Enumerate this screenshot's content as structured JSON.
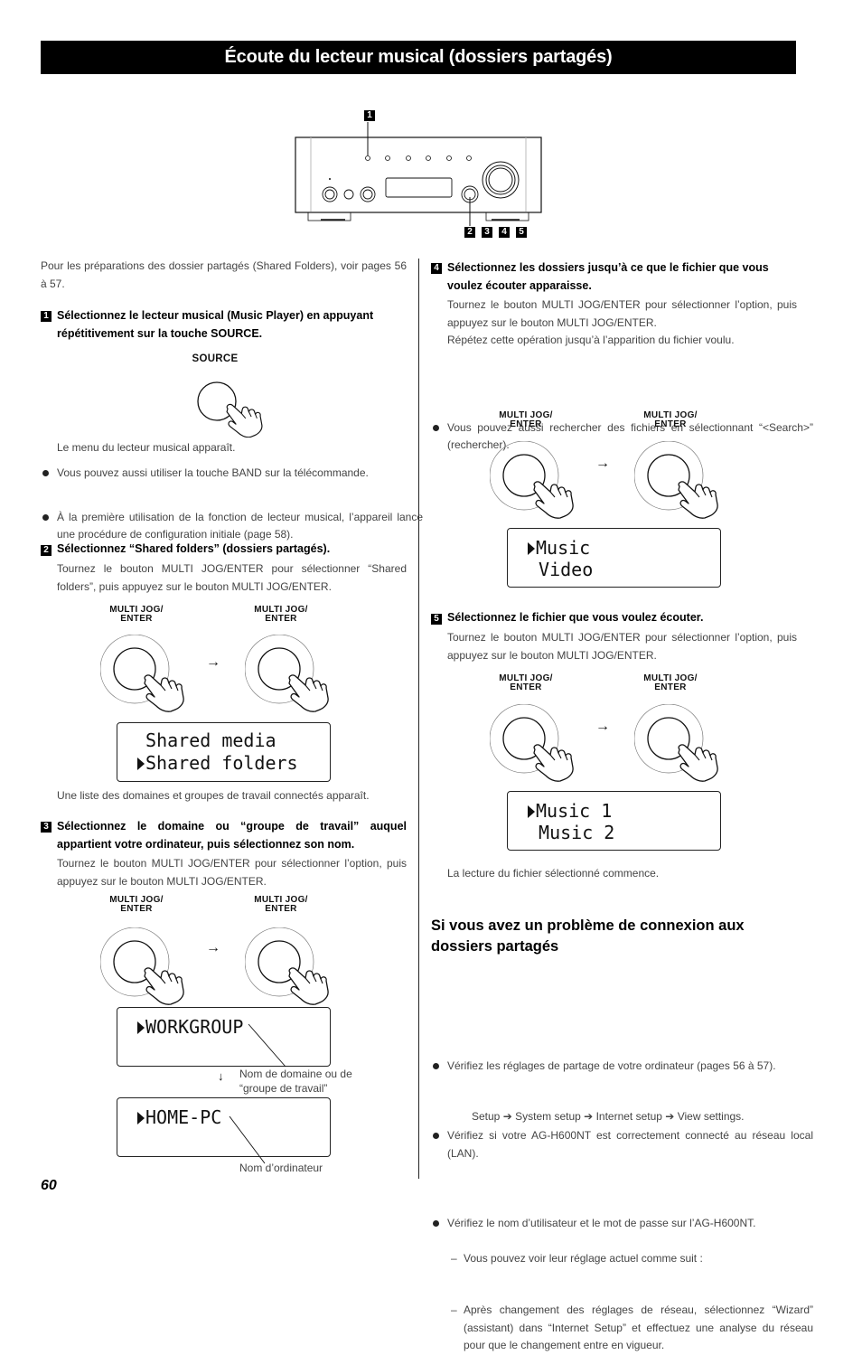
{
  "page": {
    "title": "Écoute du lecteur musical (dossiers partagés)",
    "page_number": "60"
  },
  "device_figure": {
    "callout_top": "1",
    "callouts_bottom": [
      "2",
      "3",
      "4",
      "5"
    ]
  },
  "left": {
    "intro": "Pour les préparations des dossier partagés (Shared Folders), voir pages 56 à 57.",
    "step1": {
      "num": "1",
      "heading": "Sélectionnez le lecteur musical (Music Player) en appuyant répétitivement sur la touche SOURCE.",
      "button_label": "SOURCE",
      "result": "Le menu du lecteur musical apparaît.",
      "bullets": [
        "Vous pouvez aussi utiliser la touche BAND sur la télécommande.",
        "À la première utilisation de la fonction de lecteur musical, l’appareil lance une procédure de configuration initiale (page 58)."
      ]
    },
    "step2": {
      "num": "2",
      "heading": "Sélectionnez “Shared folders” (dossiers partagés).",
      "body": "Tournez le bouton MULTI JOG/ENTER pour sélectionner “Shared folders”, puis appuyez sur le bouton MULTI JOG/ENTER.",
      "knob_label_1": "MULTI JOG/",
      "knob_label_2": "ENTER",
      "lcd_line1": " Shared media",
      "lcd_line2": "Shared folders",
      "result": "Une liste des domaines et groupes de travail connectés apparaît."
    },
    "step3": {
      "num": "3",
      "heading": "Sélectionnez le domaine ou “groupe de travail” auquel appartient votre ordinateur, puis sélectionnez son nom.",
      "body": "Tournez le bouton MULTI JOG/ENTER pour sélectionner l’option, puis appuyez sur le bouton MULTI JOG/ENTER.",
      "knob_label_1": "MULTI JOG/",
      "knob_label_2": "ENTER",
      "lcd1_line1": "WORKGROUP",
      "lcd2_line1": "HOME-PC",
      "annotation1_line1": "Nom de domaine  ou de",
      "annotation1_line2": "“groupe de travail”",
      "annotation2": "Nom d’ordinateur"
    }
  },
  "right": {
    "step4": {
      "num": "4",
      "heading": "Sélectionnez les dossiers jusqu’à ce que le fichier que vous voulez écouter apparaisse.",
      "body1": "Tournez le bouton MULTI JOG/ENTER pour sélectionner l’option, puis appuyez sur le bouton MULTI JOG/ENTER.",
      "body2": "Répétez cette opération jusqu’à l’apparition du fichier voulu.",
      "bullet": "Vous pouvez aussi rechercher des fichiers en sélectionnant “<Search>” (rechercher).",
      "knob_label_1": "MULTI JOG/",
      "knob_label_2": "ENTER",
      "lcd_line1": "Music",
      "lcd_line2": " Video"
    },
    "step5": {
      "num": "5",
      "heading": "Sélectionnez le fichier que vous voulez écouter.",
      "body": "Tournez le bouton MULTI JOG/ENTER pour sélectionner l’option, puis appuyez sur le bouton MULTI JOG/ENTER.",
      "knob_label_1": "MULTI JOG/",
      "knob_label_2": "ENTER",
      "lcd_line1": "Music 1",
      "lcd_line2": " Music 2",
      "result": "La lecture du fichier sélectionné commence."
    },
    "troubleshoot": {
      "heading": "Si vous avez un problème de connexion aux dossiers partagés",
      "bullets": [
        "Vérifiez les réglages de partage de votre ordinateur (pages 56 à 57).",
        "Vérifiez si votre AG-H600NT est correctement connecté au réseau local (LAN).",
        "Vérifiez le nom d’utilisateur et le mot de passe sur l’AG-H600NT."
      ],
      "sub1": "Vous pouvez voir leur réglage actuel comme suit :",
      "path": [
        "Setup",
        "System setup",
        "Internet setup",
        "View settings."
      ],
      "sub2": "Après changement des réglages de réseau, sélectionnez “Wizard” (assistant) dans “Internet Setup” et effectuez une analyse du réseau pour que le changement entre en vigueur."
    }
  }
}
